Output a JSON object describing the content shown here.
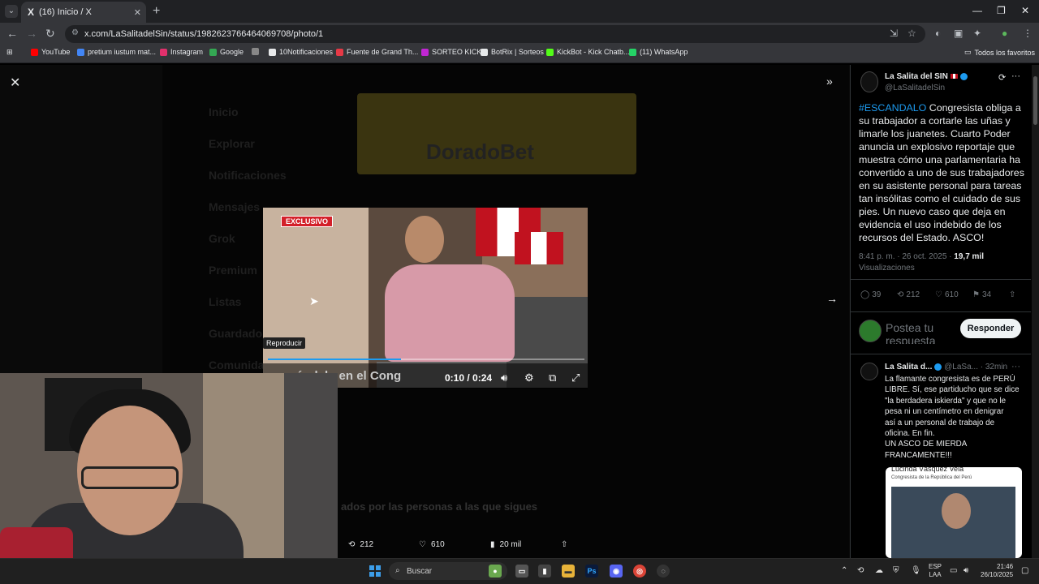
{
  "browser": {
    "tab_title": "(16) Inicio / X",
    "tab_icon": "X",
    "url": "x.com/LaSalitadelSin/status/1982623766464069708/photo/1",
    "bookmarks": [
      {
        "label": "YouTube",
        "color": "#ff0000"
      },
      {
        "label": "pretium iustum mat...",
        "color": "#4285f4"
      },
      {
        "label": "Instagram",
        "color": "#e1306c"
      },
      {
        "label": "Google",
        "color": "#34a853"
      },
      {
        "label": "",
        "color": "#888888"
      },
      {
        "label": "10Notificaciones",
        "color": "#e7e9ea"
      },
      {
        "label": "Fuente de Grand Th...",
        "color": "#e63946"
      },
      {
        "label": "SORTEO KICK",
        "color": "#c026d3"
      },
      {
        "label": "BotRix | Sorteos",
        "color": "#e7e9ea"
      },
      {
        "label": "KickBot - Kick Chatb...",
        "color": "#53fc18"
      },
      {
        "label": "(11) WhatsApp",
        "color": "#25d366"
      }
    ],
    "all_bookmarks": "Todos los favoritos"
  },
  "ghost_nav": [
    "Inicio",
    "Explorar",
    "Notificaciones",
    "Mensajes",
    "Grok",
    "Premium",
    "Listas",
    "Guardados",
    "Comunidades"
  ],
  "ghost_ad": "DoradoBet",
  "ghost_related": "ados por las personas a las que sigues",
  "video": {
    "badge": "EXCLUSIVO",
    "tooltip": "Reproducir",
    "lower_third": "escándalo en el Cong",
    "time": "0:10 / 0:24",
    "progress": 0.42
  },
  "media_stats": {
    "retweets": "212",
    "likes": "610",
    "views": "20 mil"
  },
  "tweet": {
    "author_name": "La Salita del SIN",
    "author_handle": "@LaSalitadelSin",
    "hashtag": "#ESCANDALO",
    "text": " Congresista obliga a su trabajador a cortarle las uñas y limarle los juanetes. Cuarto Poder anuncia un explosivo reportaje que muestra cómo una parlamentaria ha convertido a uno de sus trabajadores en su asistente personal para tareas tan insólitas como el cuidado de sus pies. Un nuevo caso que deja en evidencia el uso indebido de los recursos del Estado. ASCO!",
    "time": "8:41 p. m. · 26 oct. 2025 · ",
    "views": "19,7 mil",
    "views_label": "Visualizaciones",
    "replies": "39",
    "retweets": "212",
    "likes": "610",
    "bookmarks": "34"
  },
  "reply_box": {
    "placeholder": "Postea tu respuesta",
    "button": "Responder"
  },
  "reply": {
    "name": "La Salita d...",
    "handle": "@LaSa...",
    "time": "· 32min",
    "text_lines": [
      "La flamante congresista es de PERÚ",
      "LIBRE. Sí, ese partiducho que se dice",
      "\"la berdadera iskierda\" y que no le",
      "pesa ni un centímetro en denigrar",
      "así a un personal de trabajo de",
      "oficina. En fin.",
      "UN ASCO DE MIERDA",
      "FRANCAMENTE!!!"
    ],
    "image_title": "Lucinda Vásquez Vela",
    "image_subtitle": "Congresista de la República del Perú"
  },
  "taskbar": {
    "search": "Buscar",
    "lang_top": "ESP",
    "lang_bottom": "LAA",
    "time": "21:46",
    "date": "26/10/2025"
  },
  "colors": {
    "accent": "#1d9bf0",
    "background": "#000000",
    "exclusive_red": "#d3202a"
  }
}
